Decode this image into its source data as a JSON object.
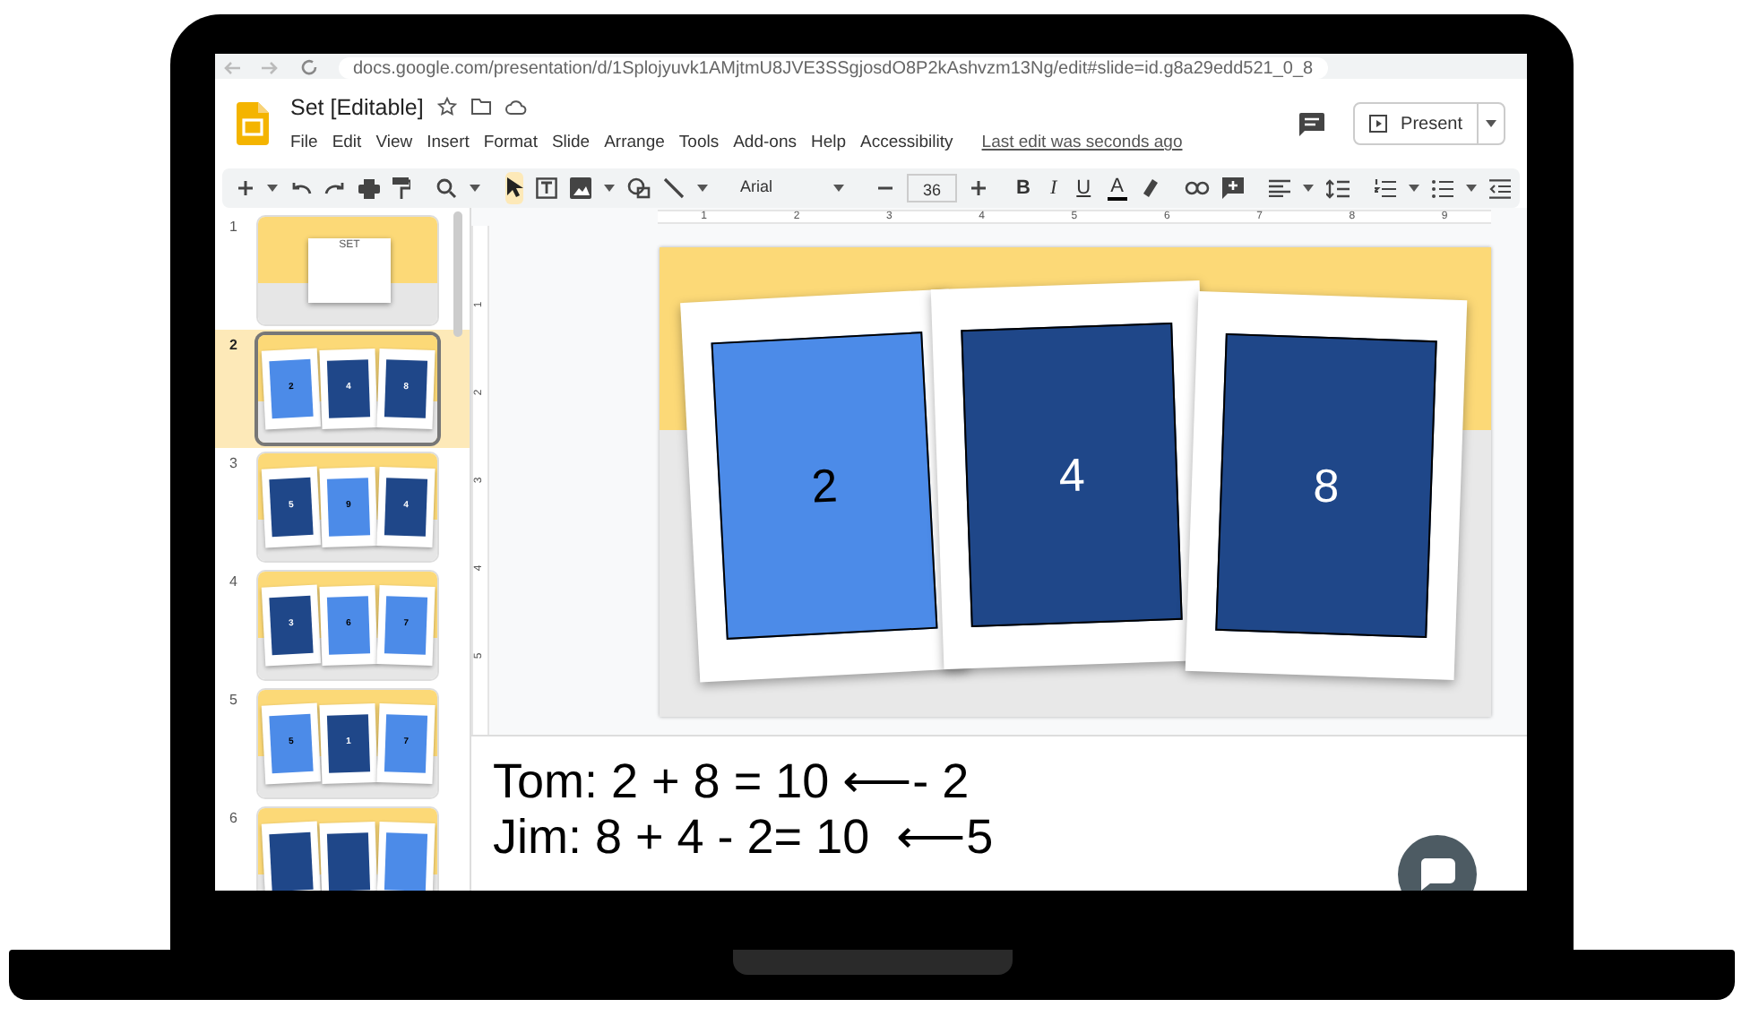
{
  "browser": {
    "url": "docs.google.com/presentation/d/1Splojyuvk1AMjtmU8JVE3SSgjosdO8P2kAshvzm13Ng/edit#slide=id.g8a29edd521_0_8"
  },
  "document": {
    "title": "Set [Editable]",
    "menu": [
      "File",
      "Edit",
      "View",
      "Insert",
      "Format",
      "Slide",
      "Arrange",
      "Tools",
      "Add-ons",
      "Help",
      "Accessibility"
    ],
    "last_edit": "Last edit was seconds ago",
    "present_button": "Present"
  },
  "toolbar": {
    "font": "Arial",
    "font_size": "36",
    "format_buttons": [
      "B",
      "I",
      "U",
      "A"
    ]
  },
  "ruler": {
    "horizontal": [
      "1",
      "2",
      "3",
      "4",
      "5",
      "6",
      "7",
      "8",
      "9"
    ],
    "vertical": [
      "1",
      "2",
      "3",
      "4",
      "5"
    ]
  },
  "filmstrip": [
    {
      "number": "1",
      "selected": false,
      "kind": "title",
      "title": "SET"
    },
    {
      "number": "2",
      "selected": true,
      "kind": "cards",
      "cards": [
        {
          "value": "2",
          "dark": false
        },
        {
          "value": "4",
          "dark": true
        },
        {
          "value": "8",
          "dark": true
        }
      ]
    },
    {
      "number": "3",
      "selected": false,
      "kind": "cards",
      "cards": [
        {
          "value": "5",
          "dark": true
        },
        {
          "value": "9",
          "dark": false
        },
        {
          "value": "4",
          "dark": true
        }
      ]
    },
    {
      "number": "4",
      "selected": false,
      "kind": "cards",
      "cards": [
        {
          "value": "3",
          "dark": true
        },
        {
          "value": "6",
          "dark": false
        },
        {
          "value": "7",
          "dark": false
        }
      ]
    },
    {
      "number": "5",
      "selected": false,
      "kind": "cards",
      "cards": [
        {
          "value": "5",
          "dark": false
        },
        {
          "value": "1",
          "dark": true
        },
        {
          "value": "7",
          "dark": false
        }
      ]
    },
    {
      "number": "6",
      "selected": false,
      "kind": "cards",
      "cards": [
        {
          "dark": true
        },
        {
          "dark": true
        },
        {
          "dark": false
        }
      ]
    }
  ],
  "slide": {
    "cards": [
      {
        "value": "2",
        "dark": false
      },
      {
        "value": "4",
        "dark": true
      },
      {
        "value": "8",
        "dark": true
      }
    ]
  },
  "speaker_notes": [
    "Tom: 2 + 8 = 10 ⟵- 2",
    "Jim: 8 + 4 - 2= 10  ⟵5"
  ]
}
